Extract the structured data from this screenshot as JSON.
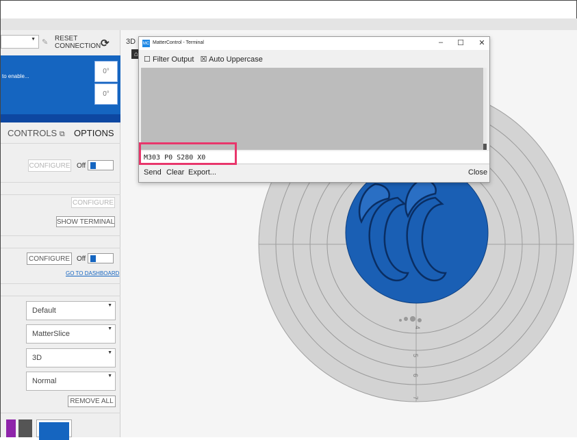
{
  "connection": {
    "reset_label_line1": "RESET",
    "reset_label_line2": "CONNECTION"
  },
  "temperature": {
    "status_text": "to enable...",
    "hotend_value": "0°",
    "bed_value": "0°"
  },
  "panel_tabs": {
    "controls_label": "CONTROLS",
    "options_label": "OPTIONS"
  },
  "options": {
    "configure_label": "CONFIGURE",
    "off_label": "Off",
    "show_terminal_label": "SHOW TERMINAL",
    "go_to_dashboard_label": "GO TO DASHBOARD",
    "remove_all_label": "REMOVE ALL",
    "dropdowns": [
      "Default",
      "MatterSlice",
      "3D",
      "Normal"
    ]
  },
  "viewport": {
    "tab_label": "3D",
    "bed_scale_labels": [
      "4",
      "5",
      "6",
      "7"
    ],
    "part_letters": "CC"
  },
  "terminal": {
    "title": "MatterControl - Terminal",
    "filter_output_label": "Filter Output",
    "auto_uppercase_label": "Auto Uppercase",
    "input_value": "M303 P0 S280 X0",
    "send_label": "Send",
    "clear_label": "Clear",
    "export_label": "Export...",
    "close_label": "Close",
    "minimize_glyph": "–",
    "maximize_glyph": "☐",
    "close_glyph": "✕",
    "unchecked_glyph": "☐",
    "checked_glyph": "☒"
  },
  "colors": {
    "accent_blue": "#1565c0",
    "highlight_pink": "#e8366b",
    "swatch_purple": "#8e24aa",
    "swatch_gray": "#555555"
  }
}
